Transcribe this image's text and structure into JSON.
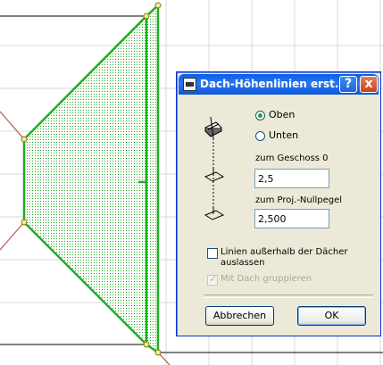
{
  "dialog": {
    "title": "Dach-Höhenlinien erst...",
    "help_label": "?",
    "close_label": "x",
    "radio_top_label": "Oben",
    "radio_bottom_label": "Unten",
    "story_label": "zum Geschoss 0",
    "story_value": "2,5",
    "projzero_label": "zum Proj.-Nullpegel",
    "projzero_value": "2,500",
    "skip_outside_label_line1": "Linien außerhalb der Dächer",
    "skip_outside_label_line2": "auslassen",
    "group_with_roof_label": "Mit Dach gruppieren",
    "cancel_label": "Abbrechen",
    "ok_label": "OK",
    "top_selected": true,
    "skip_outside_checked": false,
    "group_checked": true,
    "group_enabled": false
  },
  "colors": {
    "roof_outline": "#1fae1f",
    "handle": "#b8a500",
    "grid": "#d9d9d9",
    "reference_line": "#b04040"
  },
  "canvas_features": [
    "grid",
    "roof-polygon",
    "reference-lines",
    "hotspot-handles"
  ]
}
